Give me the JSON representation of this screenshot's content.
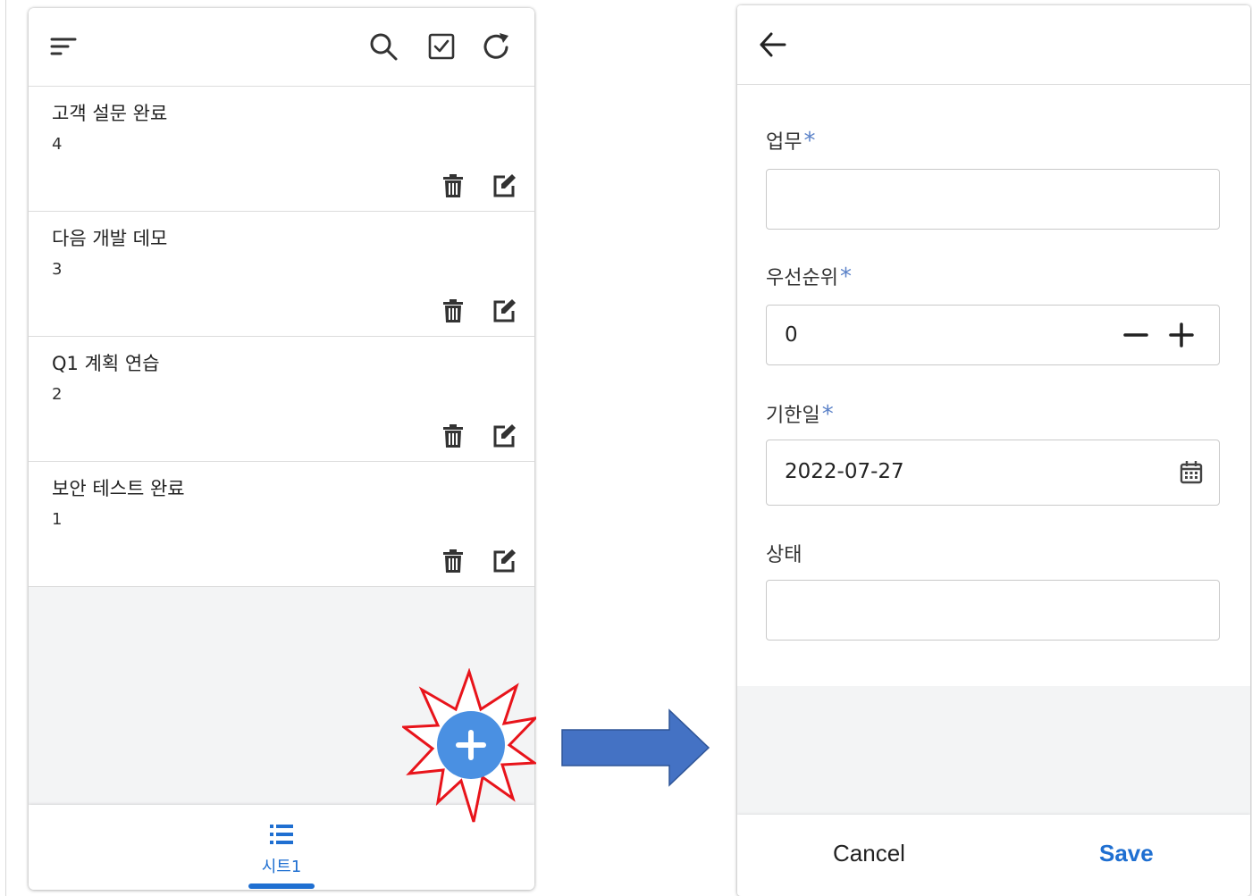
{
  "left_screen": {
    "toolbar": {
      "icons": [
        "sort-icon",
        "search-icon",
        "checkbox-icon",
        "refresh-icon"
      ]
    },
    "items": [
      {
        "title": "고객 설문 완료",
        "value": "4"
      },
      {
        "title": "다음 개발 데모",
        "value": "3"
      },
      {
        "title": "Q1 계획 연습",
        "value": "2"
      },
      {
        "title": "보안 테스트 완료",
        "value": "1"
      }
    ],
    "item_actions": [
      "trash-icon",
      "edit-icon"
    ],
    "bottom_nav": {
      "tab_label": "시트1",
      "tab_icon": "list-icon"
    },
    "fab": {
      "icon": "plus-icon",
      "highlight": "red starburst"
    }
  },
  "right_screen": {
    "header": {
      "back_icon": "arrow-left-icon"
    },
    "fields": {
      "task": {
        "label": "업무",
        "required": "*",
        "value": ""
      },
      "priority": {
        "label": "우선순위",
        "required": "*",
        "value": "0"
      },
      "due_date": {
        "label": "기한일",
        "required": "*",
        "value": "2022-07-27"
      },
      "status": {
        "label": "상태",
        "value": ""
      }
    },
    "actions": {
      "cancel": "Cancel",
      "save": "Save"
    }
  },
  "colors": {
    "accent": "#1f6fd1",
    "required_asterisk": "#5b82c8",
    "fab": "#4a90e2",
    "burst": "#e8141b",
    "arrow": "#4472c4"
  }
}
